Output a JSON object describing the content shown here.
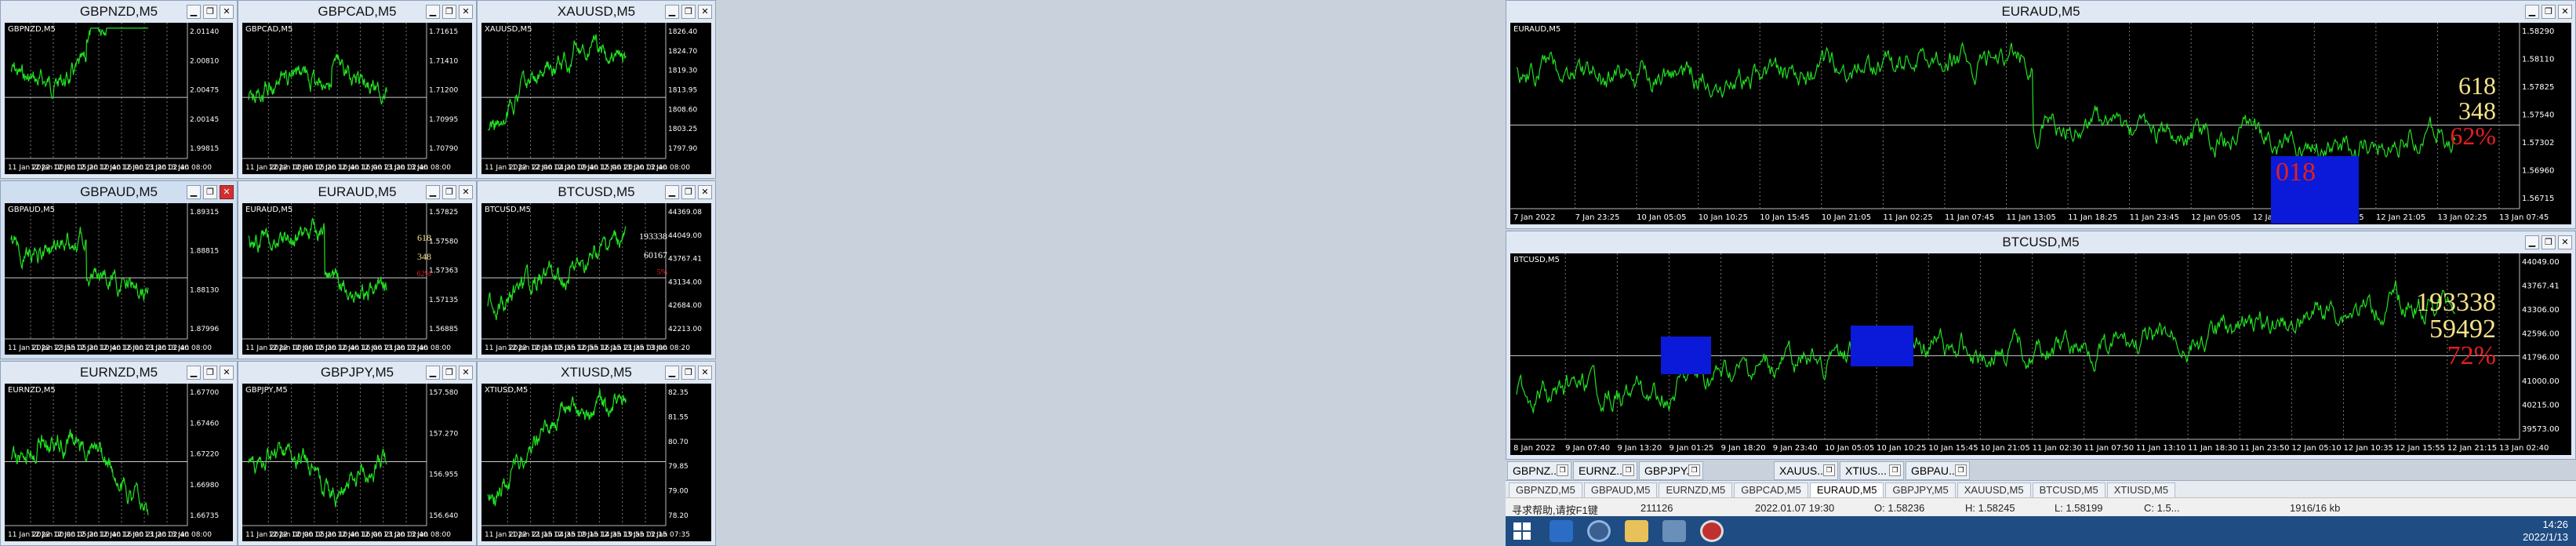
{
  "windows": [
    {
      "id": "w1",
      "title": "GBPNZD,M5",
      "label": "GBPNZD,M5",
      "axis": [
        "11 Jan 2022",
        "12 Jan 00:00",
        "12 Jan 05:20",
        "12 Jan 10:40",
        "12 Jan 16:00",
        "12 Jan 21:20",
        "13 Jan 02:40",
        "13 Jan 08:00"
      ],
      "prices": [
        "2.01140",
        "2.00810",
        "2.00475",
        "2.00145",
        "1.99815"
      ],
      "color": "#21e021"
    },
    {
      "id": "w2",
      "title": "GBPCAD,M5",
      "label": "GBPCAD,M5",
      "axis": [
        "11 Jan 2022",
        "12 Jan 00:00",
        "12 Jan 05:20",
        "12 Jan 10:40",
        "12 Jan 16:00",
        "12 Jan 21:20",
        "13 Jan 02:40",
        "13 Jan 08:00"
      ],
      "prices": [
        "1.71615",
        "1.71410",
        "1.71200",
        "1.70995",
        "1.70790"
      ],
      "color": "#21e021"
    },
    {
      "id": "w3",
      "title": "XAUUSD,M5",
      "label": "XAUUSD,M5",
      "axis": [
        "11 Jan 2022",
        "11 Jan 22:00",
        "12 Jan 04:20",
        "12 Jan 09:40",
        "12 Jan 15:00",
        "12 Jan 20:20",
        "13 Jan 02:40",
        "13 Jan 08:00"
      ],
      "prices": [
        "1826.40",
        "1824.70",
        "1819.30",
        "1813.95",
        "1808.60",
        "1803.25",
        "1797.90"
      ],
      "color": "#21e021"
    },
    {
      "id": "w4",
      "title": "GBPAUD,M5",
      "label": "GBPAUD,M5",
      "axis": [
        "11 Jan 2022",
        "11 Jan 23:55",
        "12 Jan 05:20",
        "12 Jan 10:40",
        "12 Jan 16:00",
        "12 Jan 21:20",
        "13 Jan 02:40",
        "13 Jan 08:00"
      ],
      "prices": [
        "1.89315",
        "1.88815",
        "1.88130",
        "1.87996"
      ],
      "color": "#21e021"
    },
    {
      "id": "w5",
      "title": "EURAUD,M5",
      "label": "EURAUD,M5",
      "axis": [
        "11 Jan 2022",
        "12 Jan 00:00",
        "12 Jan 05:20",
        "12 Jan 10:40",
        "12 Jan 16:00",
        "12 Jan 21:20",
        "13 Jan 02:40",
        "13 Jan 08:00"
      ],
      "prices": [
        "1.57825",
        "1.57580",
        "1.57363",
        "1.57135",
        "1.56885"
      ],
      "stats": [
        "618",
        "348",
        "62%"
      ],
      "color": "#21e021"
    },
    {
      "id": "w6",
      "title": "BTCUSD,M5",
      "label": "BTCUSD,M5",
      "axis": [
        "11 Jan 2022",
        "12 Jan 00:15",
        "12 Jan 05:35",
        "12 Jan 10:55",
        "12 Jan 16:15",
        "12 Jan 21:35",
        "13 Jan 03:00",
        "13 Jan 08:20"
      ],
      "prices": [
        "44369.08",
        "44049.00",
        "43767.41",
        "43134.00",
        "42684.00",
        "42213.00"
      ],
      "stats": [
        "193338",
        "60167",
        "5%"
      ],
      "color": "#21e021"
    },
    {
      "id": "w7",
      "title": "EURNZD,M5",
      "label": "EURNZD,M5",
      "axis": [
        "11 Jan 2022",
        "12 Jan 00:00",
        "12 Jan 05:20",
        "12 Jan 10:40",
        "12 Jan 16:00",
        "12 Jan 21:20",
        "13 Jan 02:40",
        "13 Jan 08:00"
      ],
      "prices": [
        "1.67700",
        "1.67460",
        "1.67220",
        "1.66980",
        "1.66735"
      ],
      "color": "#21e021"
    },
    {
      "id": "w8",
      "title": "GBPJPY,M5",
      "label": "GBPJPY,M5",
      "axis": [
        "11 Jan 2022",
        "12 Jan 00:00",
        "12 Jan 05:20",
        "12 Jan 10:40",
        "12 Jan 16:00",
        "12 Jan 21:20",
        "13 Jan 02:40",
        "13 Jan 08:00"
      ],
      "prices": [
        "157.580",
        "157.270",
        "156.955",
        "156.640"
      ],
      "color": "#21e021"
    },
    {
      "id": "w9",
      "title": "XTIUSD,M5",
      "label": "XTIUSD,M5",
      "axis": [
        "11 Jan 2022",
        "11 Jan 21:15",
        "12 Jan 04:35",
        "12 Jan 09:15",
        "12 Jan 14:35",
        "12 Jan 19:55",
        "13 Jan 02:15",
        "13 Jan 07:35"
      ],
      "prices": [
        "82.35",
        "81.55",
        "80.70",
        "79.85",
        "79.00",
        "78.20"
      ],
      "color": "#21e021"
    }
  ],
  "big_windows": [
    {
      "id": "b1",
      "title": "EURAUD,M5",
      "label": "EURAUD,M5",
      "axis": [
        "7 Jan 2022",
        "7 Jan 23:25",
        "10 Jan 05:05",
        "10 Jan 10:25",
        "10 Jan 15:45",
        "10 Jan 21:05",
        "11 Jan 02:25",
        "11 Jan 07:45",
        "11 Jan 13:05",
        "11 Jan 18:25",
        "11 Jan 23:45",
        "12 Jan 05:05",
        "12 Jan 10:25",
        "12 Jan 15:45",
        "12 Jan 21:05",
        "13 Jan 02:25",
        "13 Jan 07:45"
      ],
      "prices": [
        "1.58290",
        "1.58110",
        "1.57825",
        "1.57540",
        "1.57302",
        "1.56960",
        "1.56715"
      ],
      "stats": [
        "618",
        "348",
        "62%"
      ],
      "box": "018"
    },
    {
      "id": "b2",
      "title": "BTCUSD,M5",
      "label": "BTCUSD,M5",
      "axis": [
        "8 Jan 2022",
        "9 Jan 07:40",
        "9 Jan 13:20",
        "9 Jan 01:25",
        "9 Jan 18:20",
        "9 Jan 23:40",
        "10 Jan 05:05",
        "10 Jan 10:25",
        "10 Jan 15:45",
        "10 Jan 21:05",
        "11 Jan 02:30",
        "11 Jan 07:50",
        "11 Jan 13:10",
        "11 Jan 18:30",
        "11 Jan 23:50",
        "12 Jan 05:10",
        "12 Jan 10:35",
        "12 Jan 15:55",
        "12 Jan 21:15",
        "13 Jan 02:40"
      ],
      "prices": [
        "44049.00",
        "43767.41",
        "43306.00",
        "42596.00",
        "41796.00",
        "41000.00",
        "40215.00",
        "39573.00"
      ],
      "stats": [
        "193338",
        "59492",
        "72%"
      ]
    }
  ],
  "taskbar_tabs": [
    "GBPNZD,M5",
    "GBPAUD,M5",
    "EURNZD,M5",
    "GBPCAD,M5",
    "EURAUD,M5",
    "GBPJPY,M5",
    "XAUUSD,M5",
    "BTCUSD,M5",
    "XTIUSD,M5"
  ],
  "minimized": [
    "GBPNZ...",
    "EURNZ...",
    "GBPJPY...",
    "XAUUS...",
    "XTIUS...",
    "GBPAU..."
  ],
  "status": {
    "help": "寻求帮助,请按F1键",
    "bars": "211126",
    "datetime": "2022.01.07 19:30",
    "open": "O: 1.58236",
    "high": "H: 1.58245",
    "low": "L: 1.58199",
    "close": "C: 1.5...",
    "traffic": "1916/16 kb"
  },
  "clock": {
    "time": "14:26",
    "date": "2022/1/13"
  },
  "colors": {
    "line": "#21e021",
    "frame": "#dfe8f3",
    "box": "#0a1ad8",
    "stat_yellow": "#f5e28a",
    "stat_red": "#e02020"
  }
}
